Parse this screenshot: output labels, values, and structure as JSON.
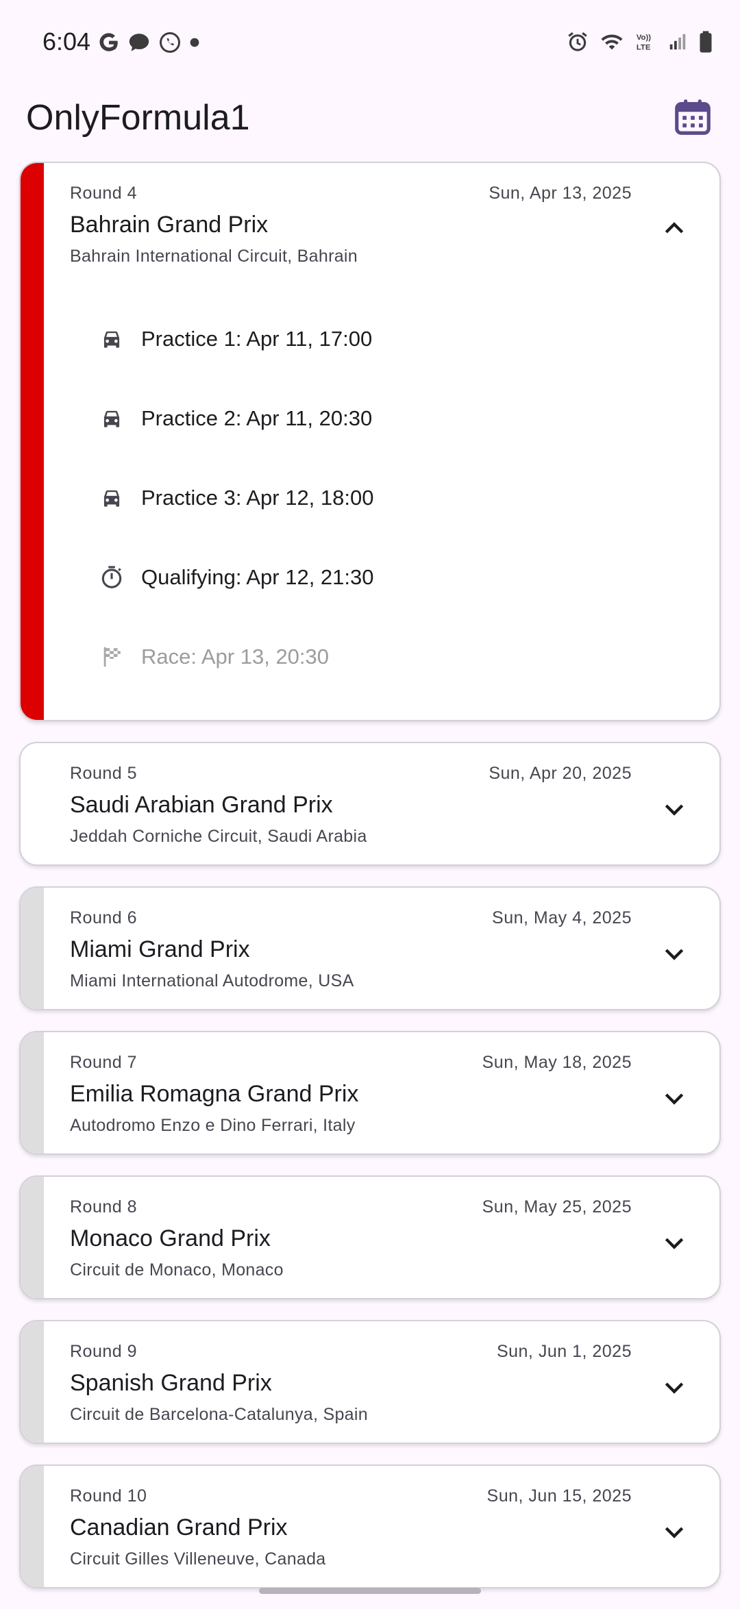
{
  "status_bar": {
    "time": "6:04"
  },
  "app": {
    "title": "OnlyFormula1"
  },
  "colors": {
    "accent": "#5b4b8a",
    "current_round": "#dd0000",
    "inactive_stripe": "#dedede"
  },
  "races": [
    {
      "round": "Round 4",
      "date": "Sun, Apr 13, 2025",
      "name": "Bahrain Grand Prix",
      "circuit": "Bahrain International Circuit, Bahrain",
      "expanded": true,
      "sessions": [
        {
          "label": "Practice 1: Apr 11, 17:00",
          "icon": "car-icon"
        },
        {
          "label": "Practice 2: Apr 11, 20:30",
          "icon": "car-icon"
        },
        {
          "label": "Practice 3: Apr 12, 18:00",
          "icon": "car-icon"
        },
        {
          "label": "Qualifying: Apr 12, 21:30",
          "icon": "timer-icon"
        },
        {
          "label": "Race: Apr 13, 20:30",
          "icon": "flag-icon"
        }
      ]
    },
    {
      "round": "Round 5",
      "date": "Sun, Apr 20, 2025",
      "name": "Saudi Arabian Grand Prix",
      "circuit": "Jeddah Corniche Circuit, Saudi Arabia"
    },
    {
      "round": "Round 6",
      "date": "Sun, May 4, 2025",
      "name": "Miami Grand Prix",
      "circuit": "Miami International Autodrome, USA"
    },
    {
      "round": "Round 7",
      "date": "Sun, May 18, 2025",
      "name": "Emilia Romagna Grand Prix",
      "circuit": "Autodromo Enzo e Dino Ferrari, Italy"
    },
    {
      "round": "Round 8",
      "date": "Sun, May 25, 2025",
      "name": "Monaco Grand Prix",
      "circuit": "Circuit de Monaco, Monaco"
    },
    {
      "round": "Round 9",
      "date": "Sun, Jun 1, 2025",
      "name": "Spanish Grand Prix",
      "circuit": "Circuit de Barcelona-Catalunya, Spain"
    },
    {
      "round": "Round 10",
      "date": "Sun, Jun 15, 2025",
      "name": "Canadian Grand Prix",
      "circuit": "Circuit Gilles Villeneuve, Canada"
    }
  ]
}
